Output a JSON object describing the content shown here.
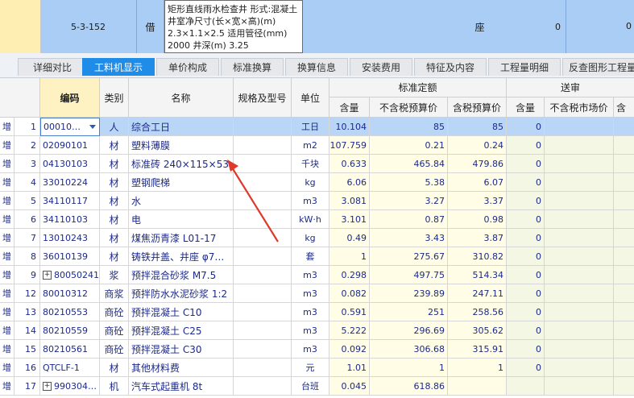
{
  "top_row": {
    "code": "5-3-152",
    "kind": "借",
    "description": "矩形直线雨水检查井 形式:混凝土 井室净尺寸(长×宽×高)(m) 2.3×1.1×2.5 适用管径(mm) 2000 井深(m) 3.25",
    "unit": "座",
    "qty": "0",
    "qty2": "0"
  },
  "tabs": [
    {
      "label": "详细对比",
      "active": false
    },
    {
      "label": "工料机显示",
      "active": true
    },
    {
      "label": "单价构成",
      "active": false
    },
    {
      "label": "标准换算",
      "active": false
    },
    {
      "label": "换算信息",
      "active": false
    },
    {
      "label": "安装费用",
      "active": false
    },
    {
      "label": "特征及内容",
      "active": false
    },
    {
      "label": "工程量明细",
      "active": false
    },
    {
      "label": "反查图形工程量",
      "active": false
    }
  ],
  "headers": {
    "code": "编码",
    "kind": "类别",
    "name": "名称",
    "spec": "规格及型号",
    "unit": "单位",
    "std_group": "标准定额",
    "std_qty": "含量",
    "std_price_ex": "不含税预算价",
    "std_price_in": "含税预算价",
    "review_group": "送审",
    "rev_qty": "含量",
    "rev_price_ex": "不含税市场价",
    "rev_price_in": "含"
  },
  "rows": [
    {
      "flag": "增",
      "idx": "1",
      "code": "00010…",
      "kind": "人",
      "name": "综合工日",
      "spec": "",
      "unit": "工日",
      "qty": "10.104",
      "p1": "85",
      "p2": "85",
      "q2": "0",
      "expand": false,
      "selected": true
    },
    {
      "flag": "增",
      "idx": "2",
      "code": "02090101",
      "kind": "材",
      "name": "塑料薄膜",
      "spec": "",
      "unit": "m2",
      "qty": "107.759",
      "p1": "0.21",
      "p2": "0.24",
      "q2": "0",
      "expand": false,
      "selected": false
    },
    {
      "flag": "增",
      "idx": "3",
      "code": "04130103",
      "kind": "材",
      "name": "标准砖 240×115×53",
      "spec": "",
      "unit": "千块",
      "qty": "0.633",
      "p1": "465.84",
      "p2": "479.86",
      "q2": "0",
      "expand": false,
      "selected": false
    },
    {
      "flag": "增",
      "idx": "4",
      "code": "33010224",
      "kind": "材",
      "name": "塑钢爬梯",
      "spec": "",
      "unit": "kg",
      "qty": "6.06",
      "p1": "5.38",
      "p2": "6.07",
      "q2": "0",
      "expand": false,
      "selected": false
    },
    {
      "flag": "增",
      "idx": "5",
      "code": "34110117",
      "kind": "材",
      "name": "水",
      "spec": "",
      "unit": "m3",
      "qty": "3.081",
      "p1": "3.27",
      "p2": "3.37",
      "q2": "0",
      "expand": false,
      "selected": false
    },
    {
      "flag": "增",
      "idx": "6",
      "code": "34110103",
      "kind": "材",
      "name": "电",
      "spec": "",
      "unit": "kW·h",
      "qty": "3.101",
      "p1": "0.87",
      "p2": "0.98",
      "q2": "0",
      "expand": false,
      "selected": false
    },
    {
      "flag": "增",
      "idx": "7",
      "code": "13010243",
      "kind": "材",
      "name": "煤焦沥青漆 L01-17",
      "spec": "",
      "unit": "kg",
      "qty": "0.49",
      "p1": "3.43",
      "p2": "3.87",
      "q2": "0",
      "expand": false,
      "selected": false
    },
    {
      "flag": "增",
      "idx": "8",
      "code": "36010139",
      "kind": "材",
      "name": "铸铁井盖、井座 φ7…",
      "spec": "",
      "unit": "套",
      "qty": "1",
      "p1": "275.67",
      "p2": "310.82",
      "q2": "0",
      "expand": false,
      "selected": false
    },
    {
      "flag": "增",
      "idx": "9",
      "code": "80050241",
      "kind": "浆",
      "name": "预拌混合砂浆 M7.5",
      "spec": "",
      "unit": "m3",
      "qty": "0.298",
      "p1": "497.75",
      "p2": "514.34",
      "q2": "0",
      "expand": true,
      "selected": false
    },
    {
      "flag": "增",
      "idx": "12",
      "code": "80010312",
      "kind": "商浆",
      "name": "预拌防水水泥砂浆 1:2",
      "spec": "",
      "unit": "m3",
      "qty": "0.082",
      "p1": "239.89",
      "p2": "247.11",
      "q2": "0",
      "expand": false,
      "selected": false
    },
    {
      "flag": "增",
      "idx": "13",
      "code": "80210553",
      "kind": "商砼",
      "name": "预拌混凝土 C10",
      "spec": "",
      "unit": "m3",
      "qty": "0.591",
      "p1": "251",
      "p2": "258.56",
      "q2": "0",
      "expand": false,
      "selected": false
    },
    {
      "flag": "增",
      "idx": "14",
      "code": "80210559",
      "kind": "商砼",
      "name": "预拌混凝土 C25",
      "spec": "",
      "unit": "m3",
      "qty": "5.222",
      "p1": "296.69",
      "p2": "305.62",
      "q2": "0",
      "expand": false,
      "selected": false
    },
    {
      "flag": "增",
      "idx": "15",
      "code": "80210561",
      "kind": "商砼",
      "name": "预拌混凝土 C30",
      "spec": "",
      "unit": "m3",
      "qty": "0.092",
      "p1": "306.68",
      "p2": "315.91",
      "q2": "0",
      "expand": false,
      "selected": false
    },
    {
      "flag": "增",
      "idx": "16",
      "code": "QTCLF-1",
      "kind": "材",
      "name": "其他材料费",
      "spec": "",
      "unit": "元",
      "qty": "1.01",
      "p1": "1",
      "p2": "1",
      "q2": "0",
      "expand": false,
      "selected": false
    },
    {
      "flag": "增",
      "idx": "17",
      "code": "990304…",
      "kind": "机",
      "name": "汽车式起重机 8t",
      "spec": "",
      "unit": "台班",
      "qty": "0.045",
      "p1": "618.86",
      "p2": "",
      "q2": "",
      "expand": true,
      "selected": false
    }
  ],
  "colors": {
    "accent": "#1f8ce8",
    "top_row": "#a9cdf5",
    "selected_row": "#b9d6f6",
    "annotation": "#e0382b"
  }
}
